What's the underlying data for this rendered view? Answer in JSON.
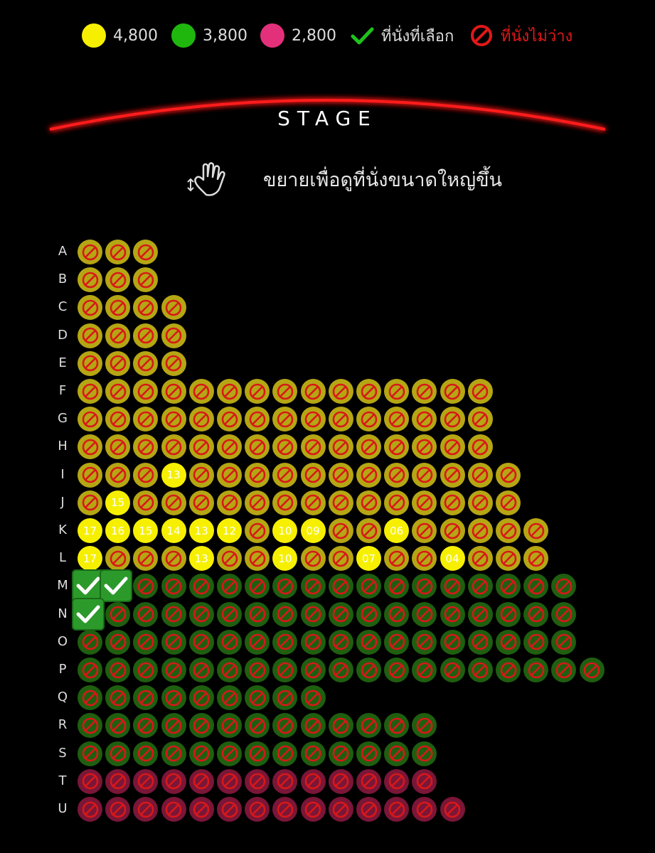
{
  "legend": {
    "price_high": {
      "label": "4,800",
      "color": "#f6f000"
    },
    "price_mid": {
      "label": "3,800",
      "color": "#1fb70e"
    },
    "price_low": {
      "label": "2,800",
      "color": "#e3307a"
    },
    "selected": {
      "label": "ที่นั่งที่เลือก",
      "icon": "check-icon"
    },
    "unavailable": {
      "label": "ที่นั่งไม่ว่าง",
      "icon": "no-entry-icon"
    }
  },
  "stage": {
    "label": "STAGE"
  },
  "zoom_hint": {
    "text": "ขยายเพื่อดูที่นั่งขนาดใหญ่ขึ้น",
    "icon": "pinch-zoom-icon"
  },
  "rows": [
    {
      "label": "A",
      "count": 3,
      "tier": "4800",
      "available": {},
      "selected": []
    },
    {
      "label": "B",
      "count": 3,
      "tier": "4800",
      "available": {},
      "selected": []
    },
    {
      "label": "C",
      "count": 4,
      "tier": "4800",
      "available": {},
      "selected": []
    },
    {
      "label": "D",
      "count": 4,
      "tier": "4800",
      "available": {},
      "selected": []
    },
    {
      "label": "E",
      "count": 4,
      "tier": "4800",
      "available": {},
      "selected": []
    },
    {
      "label": "F",
      "count": 15,
      "tier": "4800",
      "available": {},
      "selected": []
    },
    {
      "label": "G",
      "count": 15,
      "tier": "4800",
      "available": {},
      "selected": []
    },
    {
      "label": "H",
      "count": 15,
      "tier": "4800",
      "available": {},
      "selected": []
    },
    {
      "label": "I",
      "count": 16,
      "tier": "4800",
      "available": {
        "3": "13"
      },
      "selected": []
    },
    {
      "label": "J",
      "count": 16,
      "tier": "4800",
      "available": {
        "1": "15"
      },
      "selected": []
    },
    {
      "label": "K",
      "count": 17,
      "tier": "4800",
      "available": {
        "0": "17",
        "1": "16",
        "2": "15",
        "3": "14",
        "4": "13",
        "5": "12",
        "7": "10",
        "8": "09",
        "11": "06"
      },
      "selected": []
    },
    {
      "label": "L",
      "count": 17,
      "tier": "4800",
      "available": {
        "0": "17",
        "4": "13",
        "7": "10",
        "10": "07",
        "13": "04"
      },
      "selected": []
    },
    {
      "label": "M",
      "count": 18,
      "tier": "3800",
      "available": {},
      "selected": [
        0,
        1
      ]
    },
    {
      "label": "N",
      "count": 18,
      "tier": "3800",
      "available": {},
      "selected": [
        0
      ]
    },
    {
      "label": "O",
      "count": 18,
      "tier": "3800",
      "available": {},
      "selected": []
    },
    {
      "label": "P",
      "count": 19,
      "tier": "3800",
      "available": {},
      "selected": []
    },
    {
      "label": "Q",
      "count": 9,
      "tier": "3800",
      "available": {},
      "selected": []
    },
    {
      "label": "R",
      "count": 13,
      "tier": "3800",
      "available": {},
      "selected": []
    },
    {
      "label": "S",
      "count": 13,
      "tier": "3800",
      "available": {},
      "selected": []
    },
    {
      "label": "T",
      "count": 13,
      "tier": "2800",
      "available": {},
      "selected": []
    },
    {
      "label": "U",
      "count": 14,
      "tier": "2800",
      "available": {},
      "selected": []
    }
  ]
}
